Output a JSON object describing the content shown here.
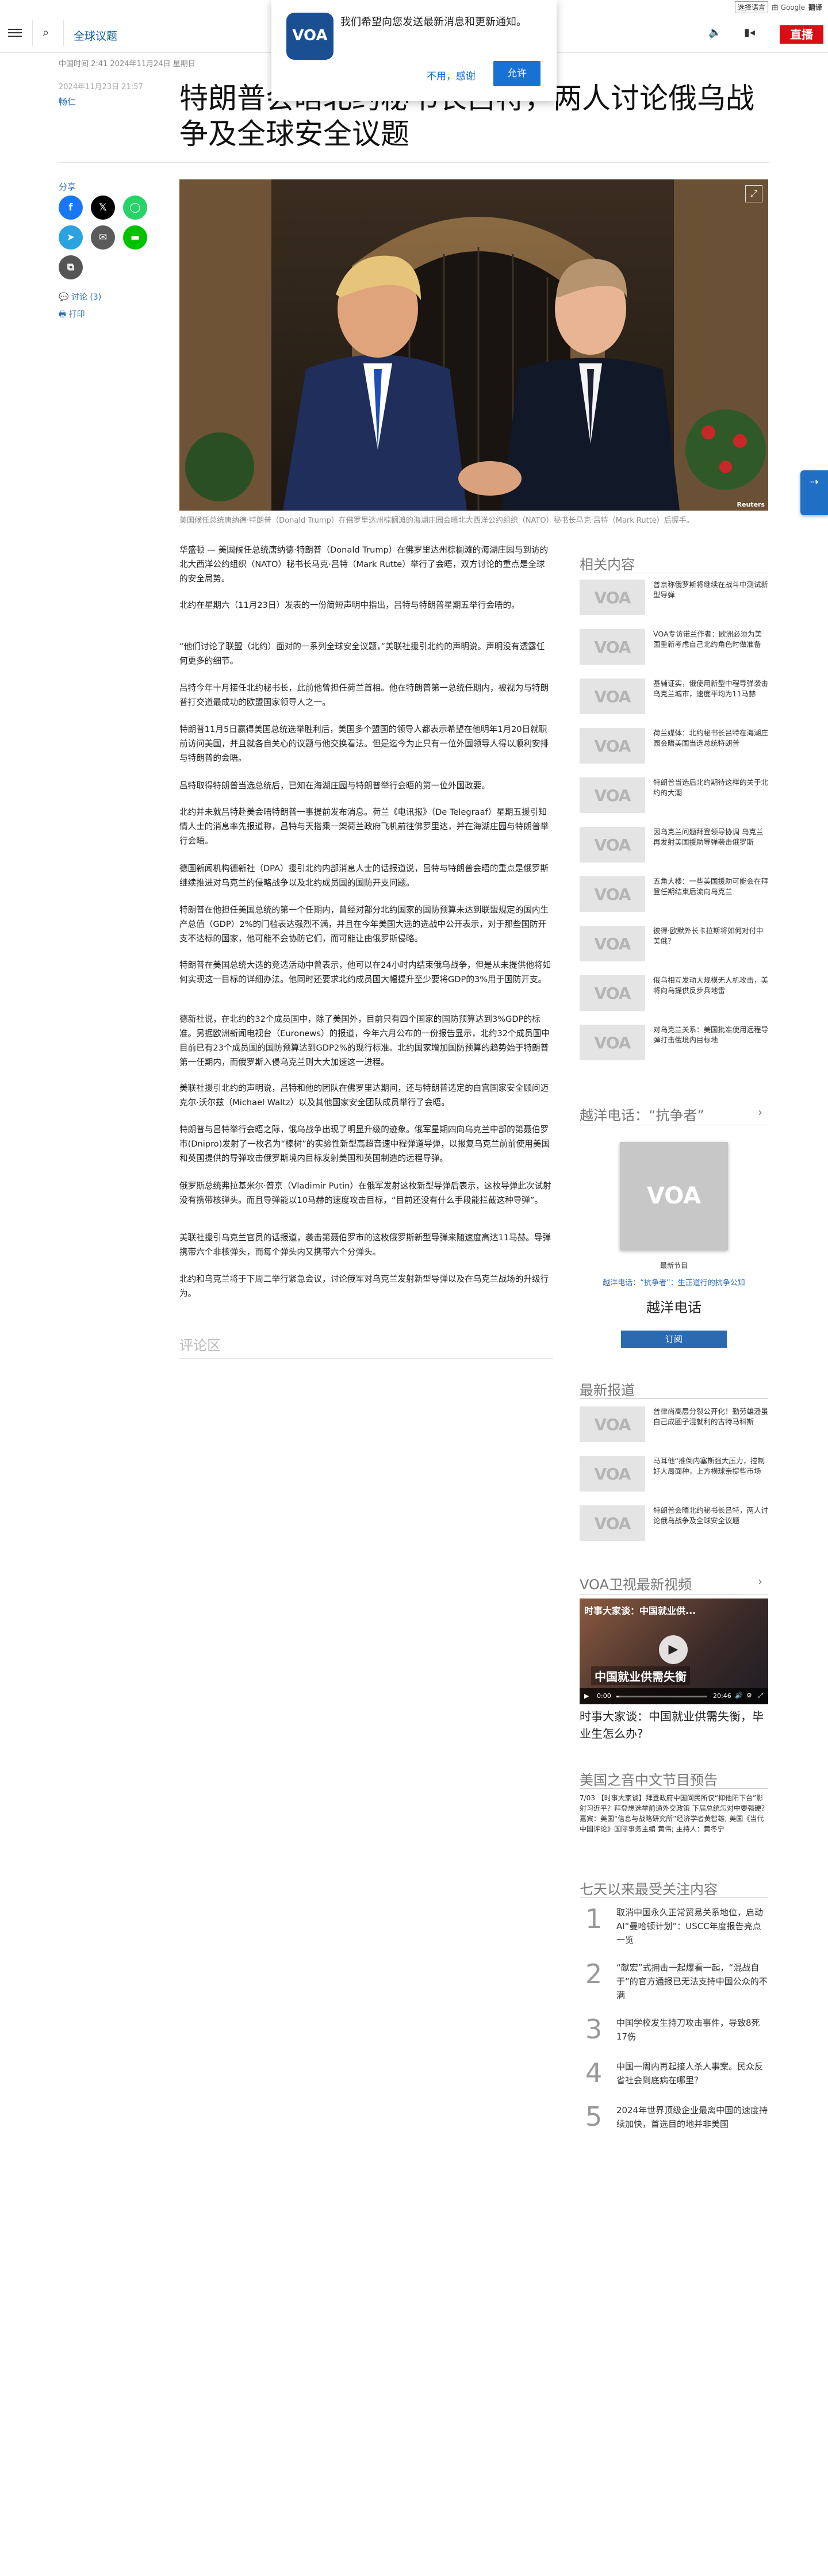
{
  "translate": {
    "select_label": "选择语言",
    "powered": "由 Google",
    "brand": "翻译"
  },
  "header": {
    "section": "全球议题",
    "live": "直播"
  },
  "notify": {
    "message": "我们希望向您发送最新消息和更新通知。",
    "no": "不用，感谢",
    "yes": "允许",
    "logo": "VOA"
  },
  "article": {
    "meta_line": "中国时间 2:41 2024年11月24日 星期日",
    "updated": "2024年11月23日 21:57",
    "author": "畅仁",
    "title": "特朗普会晤北约秘书长吕特，两人讨论俄乌战争及全球安全议题",
    "photo_caption": "美国候任总统唐纳德·特朗普（Donald Trump）在佛罗里达州棕榈滩的海湖庄园会晤北大西洋公约组织（NATO）秘书长马克·吕特（Mark Rutte）后握手。",
    "photo_credit": "Reuters",
    "paragraphs": [
      "华盛顿 — 美国候任总统唐纳德·特朗普（Donald Trump）在佛罗里达州棕榈滩的海湖庄园与到访的北大西洋公约组织（NATO）秘书长马克·吕特（Mark Rutte）举行了会晤，双方讨论的重点是全球的安全局势。",
      "北约在星期六（11月23日）发表的一份简短声明中指出，吕特与特朗普星期五举行会晤的。",
      "“他们讨论了联盟（北约）面对的一系列全球安全议题，”美联社援引北约的声明说。声明没有透露任何更多的细节。",
      "吕特今年十月接任北约秘书长，此前他曾担任荷兰首相。他在特朗普第一总统任期内，被视为与特朗普打交道最成功的欧盟国家领导人之一。",
      "特朗普11月5日赢得美国总统选举胜利后，美国多个盟国的领导人都表示希望在他明年1月20日就职前访问美国，并且就各自关心的议题与他交换看法。但是迄今为止只有一位外国领导人得以顺利安排与特朗普的会晤。",
      "吕特取得特朗普当选总统后，已知在海湖庄园与特朗普举行会晤的第一位外国政要。",
      "北约并未就吕特赴美会晤特朗普一事提前发布消息。荷兰《电讯报》（De Telegraaf）星期五援引知情人士的消息率先报道称，吕特与天搭乘一架荷兰政府飞机前往佛罗里达，并在海湖庄园与特朗普举行会晤。",
      "德国新闻机构德新社（DPA）援引北约内部消息人士的话报道说，吕特与特朗普会晤的重点是俄罗斯继续推进对乌克兰的侵略战争以及北约成员国的国防开支问题。",
      "特朗普在他担任美国总统的第一个任期内，曾经对部分北约国家的国防预算未达到联盟规定的国内生产总值（GDP）2%的门槛表达强烈不满，并且在今年美国大选的选战中公开表示，对于那些国防开支不达标的国家，他可能不会协防它们，而可能让由俄罗斯侵略。",
      "特朗普在美国总统大选的竞选活动中曾表示，他可以在24小时内结束俄乌战争，但是从未提供他将如何实现这一目标的详细办法。他同时还要求北约成员国大幅提升至少要将GDP的3%用于国防开支。",
      "德新社说，在北约的32个成员国中，除了美国外，目前只有四个国家的国防预算达到3%GDP的标准。另据欧洲新闻电视台（Euronews）的报道，今年六月公布的一份报告显示，北约32个成员国中目前已有23个成员国的国防预算达到GDP2%的现行标准。北约国家增加国防预算的趋势始于特朗普第一任期内，而俄罗斯入侵乌克兰则大大加速这一进程。",
      "美联社援引北约的声明说，吕特和他的团队在佛罗里达期间，还与特朗普选定的白宫国家安全顾问迈克尔·沃尔兹（Michael Waltz）以及其他国家安全团队成员举行了会晤。",
      "特朗普与吕特举行会晤之际，俄乌战争出现了明显升级的迹象。俄军星期四向乌克兰中部的第聂伯罗市(Dnipro)发射了一枚名为“榛树”的实验性新型高超音速中程弹道导弹，以报复乌克兰前前使用美国和英国提供的导弹攻击俄罗斯境内目标发射美国和英国制造的远程导弹。",
      "俄罗斯总统弗拉基米尔·普京（Vladimir Putin）在俄军发射这枚新型导弹后表示，这枚导弹此次试射没有携带核弹头。而且导弹能以10马赫的速度攻击目标，“目前还没有什么手段能拦截这种导弹”。",
      "美联社援引乌克兰官员的话报道，袭击第聂伯罗市的这枚俄罗斯新型导弹来随速度高达11马赫。导弹携带六个非核弹头，而每个弹头内又携带六个分弹头。",
      "北约和乌克兰将于下周二举行紧急会议，讨论俄军对乌克兰发射新型导弹以及在乌克兰战场的升级行为。"
    ],
    "comments_label": "评论区"
  },
  "share": {
    "label": "分享",
    "comments": "讨论 (3)",
    "print": "打印"
  },
  "related": {
    "title": "相关内容",
    "items": [
      "普京称俄罗斯将继续在战斗中测试新型导弹",
      "VOA专访诺兰作者：欧洲必须为美国重新考虑自己北约角色时做准备",
      "基辅证实，俄使用新型中程导弹袭击乌克兰城市，速度平均为11马赫",
      "荷兰媒体：北约秘书长吕特在海湖庄园会晤美国当选总统特朗普",
      "特朗普当选后北约期待这样的关于北约的大潮",
      "因乌克兰问题拜登领导协调 乌克兰再发射美国援助导弹袭击俄罗斯",
      "五角大楼：一些美国援助可能会在拜登任期结束后流向乌克兰",
      "彼得·欧默外长卡拉斯将如何对付中美俄？",
      "俄乌相互发动大规模无人机攻击，美将向乌提供反步兵地雷",
      "对乌克兰关系：美国批准使用远程导弹打击俄境内目标地"
    ]
  },
  "podcast": {
    "title": "越洋电话：“抗争者”",
    "label": "最新节目",
    "desc": "越洋电话：“抗争者”：生正道行的抗争公知",
    "name": "越洋电话",
    "subscribe": "订阅"
  },
  "latest": {
    "title": "最新报道",
    "items": [
      "普律尚高层分裂公开化！勤劳雄潘虽自己成圈子混就利的古特马科斯",
      "马耳他“推倒内塞斯强大压力，控制好大局面种，上方横球亲提些市场",
      "特朗普会晤北约秘书长吕特，两人讨论俄乌战争及全球安全议题"
    ]
  },
  "video": {
    "title": "VOA卫视最新视频",
    "overlay_title": "时事大家谈：中国就业供...",
    "banner": "中国就业供需失衡",
    "time_current": "0:00",
    "time_total": "20:46",
    "caption": "时事大家谈：中国就业供需失衡，毕业生怎么办?"
  },
  "schedule": {
    "title": "美国之音中文节目预告",
    "text": "7/03 【时事大家谈】拜登政府中国间民所仅“抑他阳下台”影射习近平？拜登想选举前通外交政策 下届总统怎对中要强硬？嘉宾：美国“信息与战略研究所”经济学者黄智雄; 美国《当代中国评论》国际事务主编 黄伟; 主持人：黄冬宁"
  },
  "popular": {
    "title": "七天以来最受关注内容",
    "items": [
      {
        "n": "1",
        "t": "取消中国永久正常贸易关系地位，启动AI“曼哈顿计划”：USCC年度报告亮点一览"
      },
      {
        "n": "2",
        "t": "“献宏”式拥击一起爆看一起，“混战自于”的官方通报已无法支持中国公众的不满"
      },
      {
        "n": "3",
        "t": "中国学校发生持刀攻击事件，导致8死17伤"
      },
      {
        "n": "4",
        "t": "中国一周内再起接人杀人事案。民众反省社会到底病在哪里？"
      },
      {
        "n": "5",
        "t": "2024年世界顶级企业最离中国的速度持续加快，首选目的地并非美国"
      }
    ]
  },
  "thumb_logo": "VOA",
  "colors": {
    "accent": "#2a6ab1",
    "live": "#d80e14",
    "allow": "#1872d6"
  }
}
